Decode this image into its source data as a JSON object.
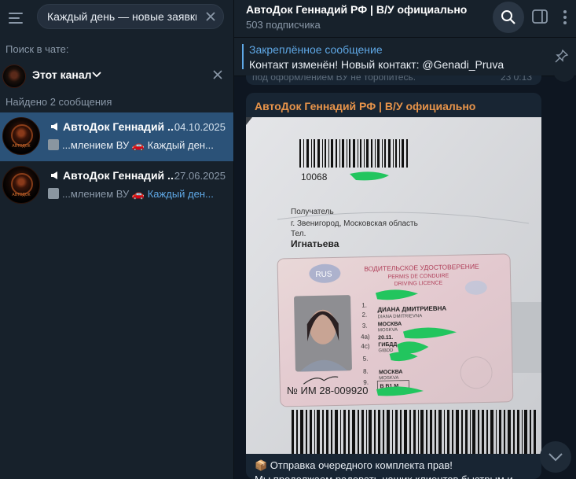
{
  "search": {
    "query": "Каждый день — новые заявки, н",
    "in_chat_label": "Поиск в чате:",
    "filter_label": "Этот канал",
    "found_label": "Найдено 2 сообщения"
  },
  "results": [
    {
      "title": "АвтоДок Геннадий ...",
      "date": "04.10.2025",
      "snippet_prefix": "...млением ВУ 🚗",
      "snippet_highlight": "Каждый ден...",
      "active": true
    },
    {
      "title": "АвтоДок Геннадий ...",
      "date": "27.06.2025",
      "snippet_prefix": "...млением ВУ 🚗",
      "snippet_highlight": "Каждый ден...",
      "active": false
    }
  ],
  "chat": {
    "title": "АвтоДок Геннадий РФ | В/У официально",
    "subscribers": "503 подписчика"
  },
  "pinned": {
    "title": "Закреплённое сообщение",
    "text": "Контакт изменён! Новый контакт: @Genadi_Pruva"
  },
  "previous_message": {
    "text": "под оформлением ВУ не торопитесь.",
    "meta": "23 0:13"
  },
  "message": {
    "author": "АвтоДок Геннадий РФ | В/У официально",
    "text_line1": "📦 Отправка очередного комплекта прав!",
    "text_line2": "Мы продолжаем радовать наших клиентов быстрым и"
  },
  "photo": {
    "tracking_number": "10068",
    "recipient_label": "Получатель",
    "recipient_city": "г. Звенигород, Московская область",
    "recipient_tel": "Тел.",
    "recipient_name": "Игнатьева",
    "card_title_ru": "ВОДИТЕЛЬСКОЕ УДОСТОВЕРЕНИЕ",
    "card_title_fr": "PERMIS DE CONDUIRE",
    "card_title_en": "DRIVING LICENCE",
    "card_country": "RUS",
    "card_name": "ДИАНА ДМИТРИЕВНА",
    "card_name_lat": "DIANA DMITRIEVNA",
    "card_city": "МОСКВА",
    "card_city_lat": "MOSKVA",
    "card_date": "20.11.",
    "card_gibdd": "ГИБДД",
    "card_gibdd_lat": "GIBDD",
    "card_categories": "B B1 M",
    "doc_number": "№ ИМ 28-009920"
  },
  "colors": {
    "accent": "#5fa8e6",
    "author": "#e8944a",
    "active_row": "#2b5278",
    "redaction": "#22c55e"
  },
  "icons": {
    "menu": "hamburger-icon",
    "search": "search-icon",
    "panel": "sidebar-toggle-icon",
    "more": "vertical-dots-icon",
    "pin": "unpin-icon",
    "scroll": "chevron-down-icon"
  }
}
